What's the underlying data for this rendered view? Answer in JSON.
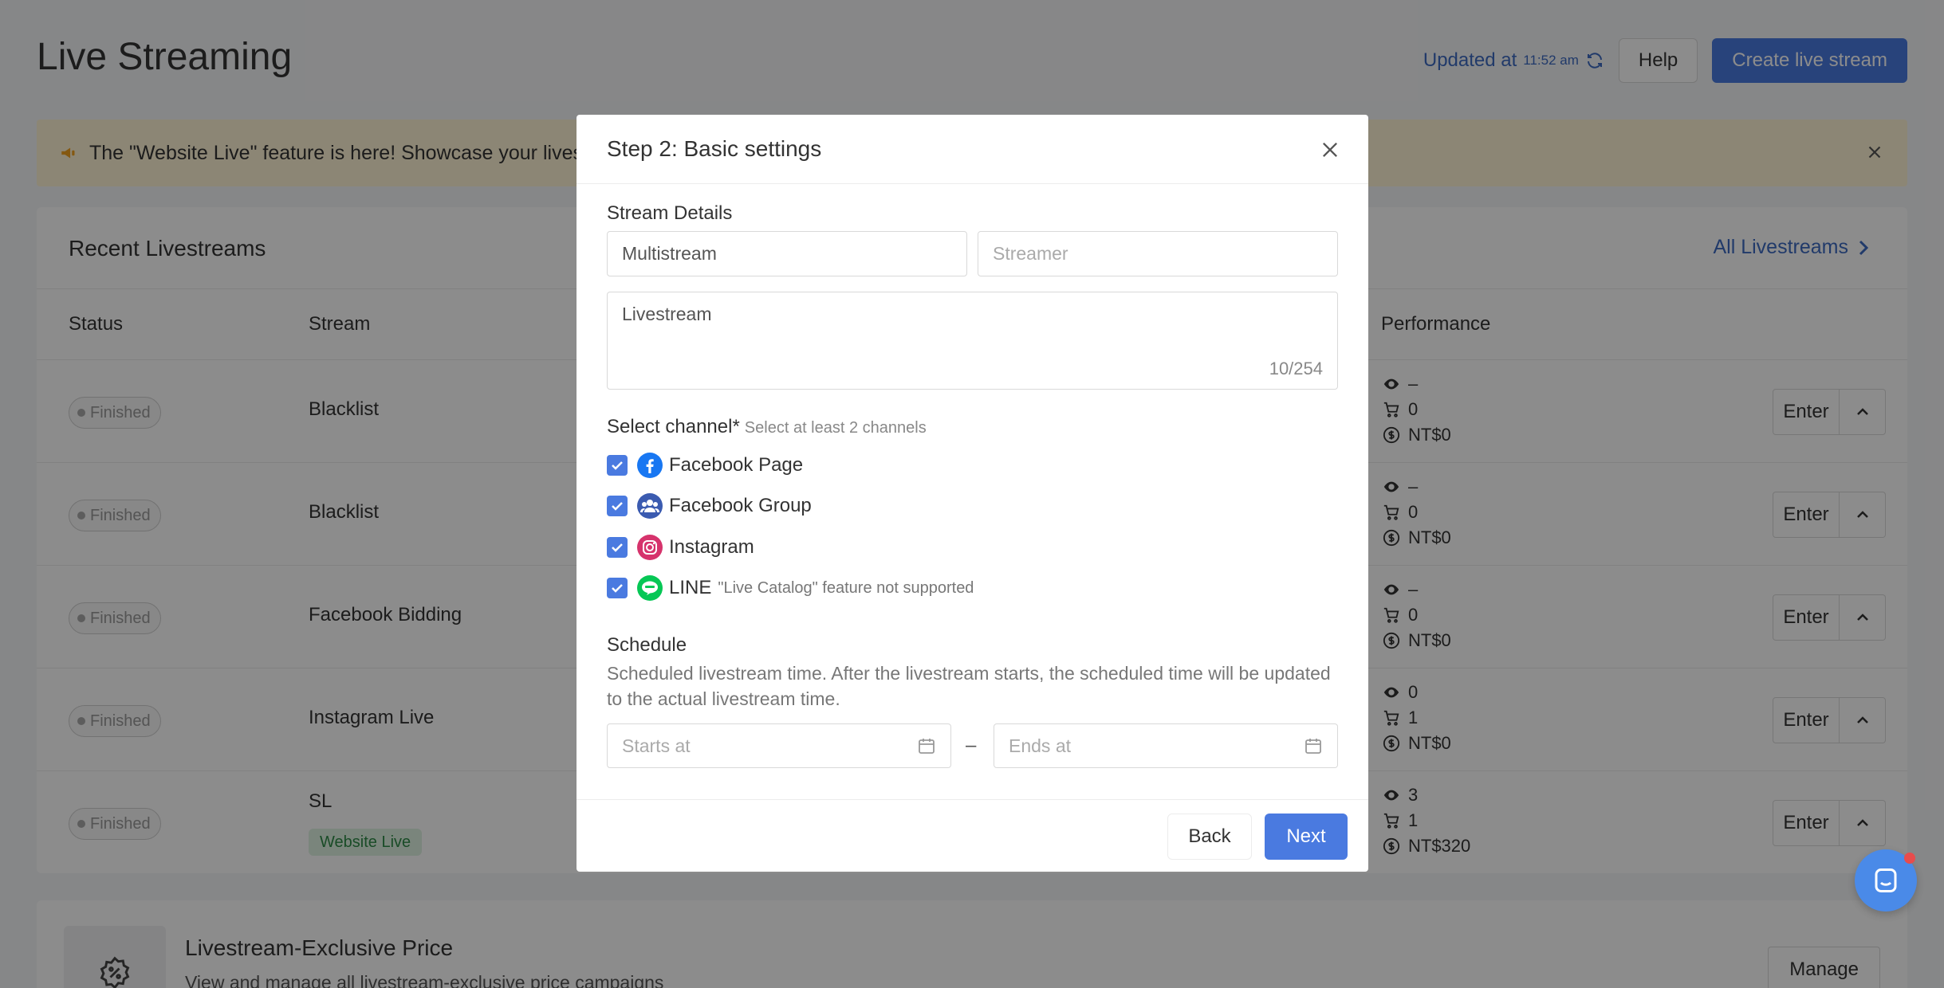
{
  "header": {
    "title": "Live Streaming",
    "updated_label": "Updated at",
    "updated_time": "11:52 am",
    "help_label": "Help",
    "create_label": "Create live stream"
  },
  "banner": {
    "text": "The \"Website Live\" feature is here! Showcase your livestr"
  },
  "recent": {
    "title": "Recent Livestreams",
    "all_link": "All Livestreams",
    "columns": {
      "status": "Status",
      "stream": "Stream",
      "performance": "Performance"
    },
    "rows": [
      {
        "status": "Finished",
        "stream": "Blacklist",
        "views": "–",
        "orders": "0",
        "revenue": "NT$0",
        "enter": "Enter"
      },
      {
        "status": "Finished",
        "stream": "Blacklist",
        "views": "–",
        "orders": "0",
        "revenue": "NT$0",
        "enter": "Enter"
      },
      {
        "status": "Finished",
        "stream": "Facebook Bidding",
        "views": "–",
        "orders": "0",
        "revenue": "NT$0",
        "enter": "Enter"
      },
      {
        "status": "Finished",
        "stream": "Instagram Live",
        "views": "0",
        "orders": "1",
        "revenue": "NT$0",
        "enter": "Enter"
      },
      {
        "status": "Finished",
        "stream": "SL",
        "badge": "Website Live",
        "views": "3",
        "orders": "1",
        "revenue": "NT$320",
        "enter": "Enter"
      }
    ]
  },
  "exclusive": {
    "title": "Livestream-Exclusive Price",
    "desc": "View and manage all livestream-exclusive price campaigns",
    "manage_label": "Manage"
  },
  "modal": {
    "title": "Step 2: Basic settings",
    "stream_details_label": "Stream Details",
    "stream_type_value": "Multistream",
    "streamer_placeholder": "Streamer",
    "description_value": "Livestream",
    "description_counter": "10/254",
    "channel_label": "Select channel",
    "channel_required": "*",
    "channel_hint": "Select at least 2 channels",
    "channels": [
      {
        "name": "Facebook Page",
        "icon": "facebook-icon",
        "checked": true,
        "note": ""
      },
      {
        "name": "Facebook Group",
        "icon": "facebook-group-icon",
        "checked": true,
        "note": ""
      },
      {
        "name": "Instagram",
        "icon": "instagram-icon",
        "checked": true,
        "note": ""
      },
      {
        "name": "LINE",
        "icon": "line-icon",
        "checked": true,
        "note": "\"Live Catalog\" feature not supported"
      }
    ],
    "schedule_label": "Schedule",
    "schedule_desc": "Scheduled livestream time. After the livestream starts, the scheduled time will be updated to the actual livestream time.",
    "starts_placeholder": "Starts at",
    "ends_placeholder": "Ends at",
    "date_separator": "–",
    "back_label": "Back",
    "next_label": "Next"
  },
  "colors": {
    "primary": "#4a7ae0",
    "link": "#3d6bc2",
    "banner_bg": "#fff4d6",
    "badge_green_bg": "#dff2e2",
    "badge_green_text": "#2f8a47"
  }
}
